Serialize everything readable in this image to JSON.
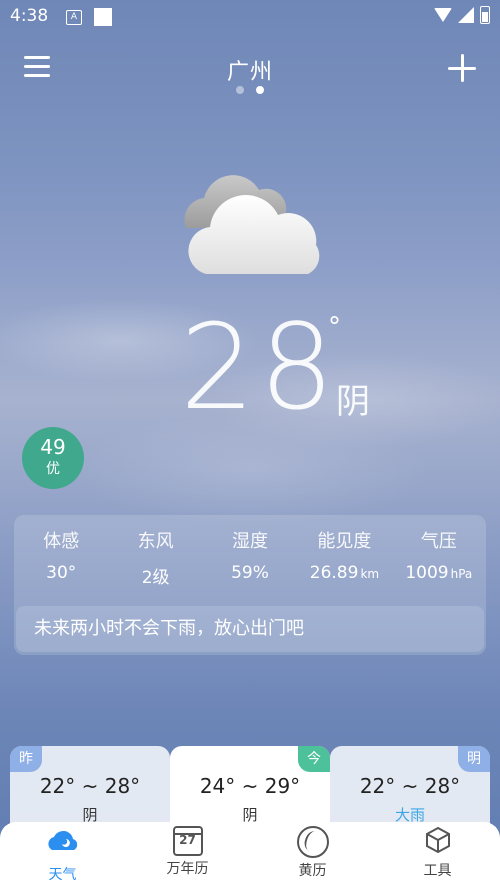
{
  "status_bar": {
    "time": "4:38",
    "a_label": "A"
  },
  "header": {
    "city": "广州"
  },
  "current": {
    "temperature": "28",
    "degree_symbol": "°",
    "condition": "阴",
    "aqi": {
      "value": "49",
      "level": "优"
    }
  },
  "details": [
    {
      "label": "体感",
      "value": "30°",
      "unit": ""
    },
    {
      "label": "东风",
      "value": "2级",
      "unit": ""
    },
    {
      "label": "湿度",
      "value": "59%",
      "unit": ""
    },
    {
      "label": "能见度",
      "value": "26.89",
      "unit": "km"
    },
    {
      "label": "气压",
      "value": "1009",
      "unit": "hPa"
    }
  ],
  "forecast_message": "未来两小时不会下雨，放心出门吧",
  "days": {
    "yesterday": {
      "tag": "昨",
      "range": "22° ~ 28°",
      "condition": "阴"
    },
    "today": {
      "tag": "今",
      "range": "24° ~ 29°",
      "condition": "阴"
    },
    "tomorrow": {
      "tag": "明",
      "range": "22° ~ 28°",
      "condition": "大雨"
    }
  },
  "tabs": [
    {
      "label": "天气",
      "icon": "weather-icon",
      "active": true
    },
    {
      "label": "万年历",
      "icon": "calendar-icon",
      "calendar_day": "27"
    },
    {
      "label": "黄历",
      "icon": "almanac-icon"
    },
    {
      "label": "工具",
      "icon": "tools-icon"
    }
  ],
  "colors": {
    "aqi_good": "#3fa88d",
    "today_tag": "#4dc29a",
    "active_tab": "#2b8ff0",
    "rain_text": "#3ca7e6"
  }
}
